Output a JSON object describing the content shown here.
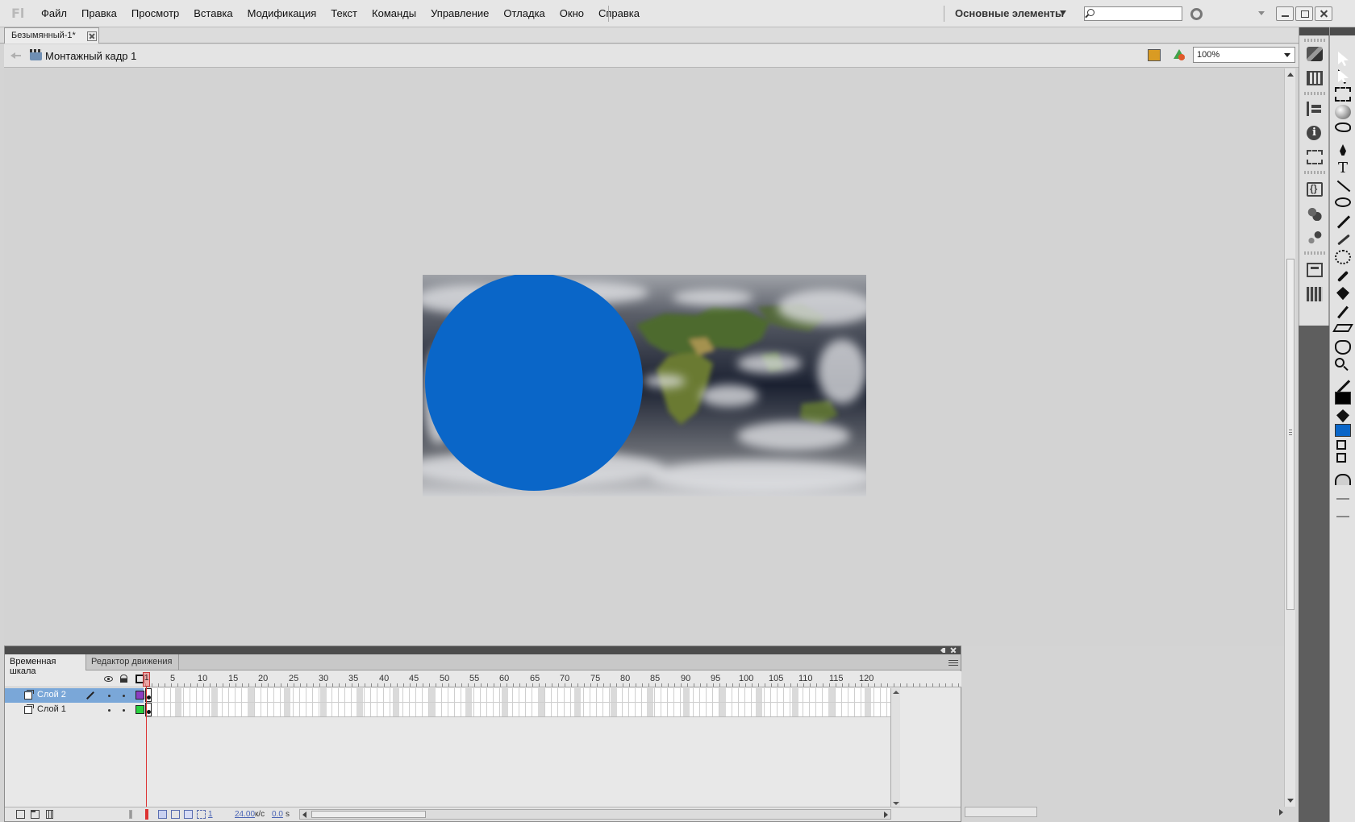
{
  "app": {
    "logo": "Fl"
  },
  "menu": [
    "Файл",
    "Правка",
    "Просмотр",
    "Вставка",
    "Модификация",
    "Текст",
    "Команды",
    "Управление",
    "Отладка",
    "Окно",
    "Справка"
  ],
  "workspace": {
    "label": "Основные элементы"
  },
  "search": {
    "placeholder": "",
    "value": ""
  },
  "document": {
    "tab_title": "Безымянный-1*"
  },
  "editbar": {
    "scene_label": "Монтажный кадр 1",
    "zoom": "100%"
  },
  "stage": {
    "circle_color": "#0a66c8",
    "background": "world cloud map"
  },
  "timeline": {
    "tabs": [
      "Временная шкала",
      "Редактор движения"
    ],
    "ruler": [
      "1",
      "5",
      "10",
      "15",
      "20",
      "25",
      "30",
      "35",
      "40",
      "45",
      "50",
      "55",
      "60",
      "65",
      "70",
      "75",
      "80",
      "85",
      "90",
      "95",
      "100",
      "105",
      "110",
      "115",
      "120"
    ],
    "layers": [
      {
        "name": "Слой 2",
        "color": "#8b3fc2",
        "active": true
      },
      {
        "name": "Слой 1",
        "color": "#29d13f",
        "active": false
      }
    ],
    "current_frame": "1",
    "fps": "24.00",
    "fps_unit": "к/с",
    "time": "0.0",
    "time_unit": "s"
  },
  "tools": {
    "stroke_color": "#000000",
    "fill_color": "#0a66c8",
    "icons": [
      "selection-icon",
      "subselection-icon",
      "free-transform-icon",
      "3d-rotation-icon",
      "lasso-icon",
      "pen-icon",
      "text-icon",
      "line-icon",
      "oval-icon",
      "pencil-icon",
      "brush-icon",
      "deco-icon",
      "bone-icon",
      "paint-bucket-icon",
      "eyedropper-icon",
      "eraser-icon",
      "hand-icon",
      "zoom-icon"
    ]
  },
  "colors": {
    "accent": "#7aa7d8",
    "dark_header": "#4c4c4c",
    "playhead": "#dd3333"
  }
}
